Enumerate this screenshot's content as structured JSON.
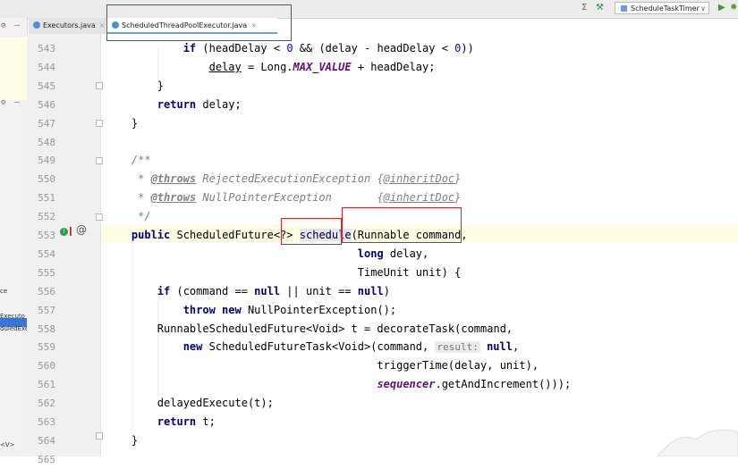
{
  "tabs": [
    {
      "label": "Executors.java",
      "close": "×"
    },
    {
      "label": "ScheduledThreadPoolExecutor.java",
      "close": "×"
    }
  ],
  "run_config": {
    "label": "ScheduleTaskTimer",
    "dropdown": "∨"
  },
  "toolbar_icons": {
    "structure": "Σ",
    "hammer": "⚒",
    "run": "▶",
    "debug": "✹"
  },
  "left_panel": {
    "gear": "⚙",
    "minus": "—",
    "fragments": [
      "ce",
      "Executo",
      "duledExec",
      "<v>",
      "<V>"
    ]
  },
  "gutter_marks": {
    "implements": "!",
    "override": "@"
  },
  "colors": {
    "keyword": "#000080",
    "number": "#0000ff",
    "comment": "#808080",
    "highlight_line": "#fefce2",
    "annotation_box": "#e02020"
  },
  "lines": [
    {
      "n": "543",
      "spans": [
        {
          "t": "            "
        },
        {
          "c": "kw",
          "t": "if"
        },
        {
          "t": " (headDelay < "
        },
        {
          "c": "num",
          "t": "0"
        },
        {
          "t": " && (delay - headDelay < "
        },
        {
          "c": "num",
          "t": "0"
        },
        {
          "t": "))"
        }
      ]
    },
    {
      "n": "544",
      "spans": [
        {
          "t": "                "
        },
        {
          "c": "ul",
          "t": "delay"
        },
        {
          "t": " = Long."
        },
        {
          "c": "fld",
          "t": "MAX_VALUE"
        },
        {
          "t": " + headDelay;"
        }
      ]
    },
    {
      "n": "545",
      "spans": [
        {
          "t": "        }"
        }
      ]
    },
    {
      "n": "546",
      "spans": [
        {
          "t": "        "
        },
        {
          "c": "kw",
          "t": "return"
        },
        {
          "t": " delay;"
        }
      ]
    },
    {
      "n": "547",
      "spans": [
        {
          "t": "    }"
        }
      ]
    },
    {
      "n": "548",
      "spans": []
    },
    {
      "n": "549",
      "spans": [
        {
          "t": "    "
        },
        {
          "c": "cm",
          "t": "/**"
        }
      ]
    },
    {
      "n": "550",
      "spans": [
        {
          "t": "     "
        },
        {
          "c": "cm",
          "t": "* "
        },
        {
          "c": "tag",
          "t": "@throws"
        },
        {
          "c": "cm",
          "t": " RejectedExecutionException {"
        },
        {
          "c": "ref",
          "t": "@inheritDoc"
        },
        {
          "c": "cm",
          "t": "}"
        }
      ]
    },
    {
      "n": "551",
      "spans": [
        {
          "t": "     "
        },
        {
          "c": "cm",
          "t": "* "
        },
        {
          "c": "tag",
          "t": "@throws"
        },
        {
          "c": "cm",
          "t": " NullPointerException       {"
        },
        {
          "c": "ref",
          "t": "@inheritDoc"
        },
        {
          "c": "cm",
          "t": "}"
        }
      ]
    },
    {
      "n": "552",
      "spans": [
        {
          "t": "     "
        },
        {
          "c": "cm",
          "t": "*/"
        }
      ]
    },
    {
      "n": "553",
      "spans": [
        {
          "t": "    "
        },
        {
          "c": "kw",
          "t": "public"
        },
        {
          "t": " ScheduledFuture<?> "
        },
        {
          "c": "ident-hl",
          "t": "schedule"
        },
        {
          "t": "(Runnable command,"
        }
      ]
    },
    {
      "n": "554",
      "spans": [
        {
          "t": "                                       "
        },
        {
          "c": "kw",
          "t": "long"
        },
        {
          "t": " delay,"
        }
      ]
    },
    {
      "n": "555",
      "spans": [
        {
          "t": "                                       TimeUnit unit) {"
        }
      ]
    },
    {
      "n": "556",
      "spans": [
        {
          "t": "        "
        },
        {
          "c": "kw",
          "t": "if"
        },
        {
          "t": " (command == "
        },
        {
          "c": "kw",
          "t": "null"
        },
        {
          "t": " || unit == "
        },
        {
          "c": "kw",
          "t": "null"
        },
        {
          "t": ")"
        }
      ]
    },
    {
      "n": "557",
      "spans": [
        {
          "t": "            "
        },
        {
          "c": "kw",
          "t": "throw new"
        },
        {
          "t": " NullPointerException();"
        }
      ]
    },
    {
      "n": "558",
      "spans": [
        {
          "t": "        RunnableScheduledFuture<Void> t = decorateTask(command,"
        }
      ]
    },
    {
      "n": "559",
      "spans": [
        {
          "t": "            "
        },
        {
          "c": "kw",
          "t": "new"
        },
        {
          "t": " ScheduledFutureTask<Void>(command, "
        },
        {
          "c": "hint",
          "t": "result:"
        },
        {
          "t": " "
        },
        {
          "c": "kw",
          "t": "null"
        },
        {
          "t": ","
        }
      ]
    },
    {
      "n": "560",
      "spans": [
        {
          "t": "                                          triggerTime(delay, unit),"
        }
      ]
    },
    {
      "n": "561",
      "spans": [
        {
          "t": "                                          "
        },
        {
          "c": "fld",
          "t": "sequencer"
        },
        {
          "t": ".getAndIncrement()));"
        }
      ]
    },
    {
      "n": "562",
      "spans": [
        {
          "t": "        delayedExecute(t);"
        }
      ]
    },
    {
      "n": "563",
      "spans": [
        {
          "t": "        "
        },
        {
          "c": "kw",
          "t": "return"
        },
        {
          "t": " t;"
        }
      ]
    },
    {
      "n": "564",
      "spans": [
        {
          "t": "    }"
        }
      ]
    },
    {
      "n": "565",
      "spans": []
    }
  ]
}
